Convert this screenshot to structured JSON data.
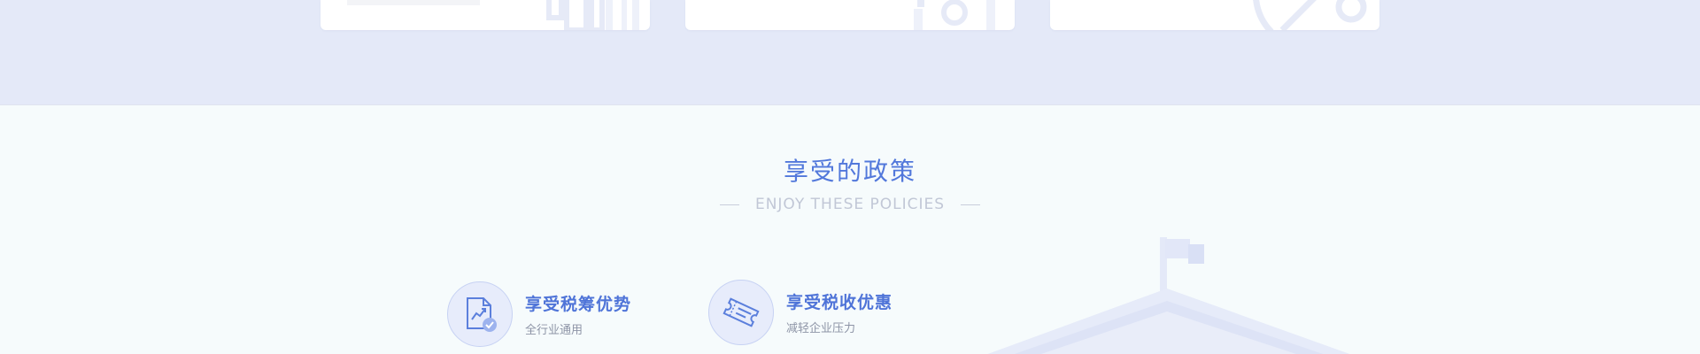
{
  "section": {
    "title": "享受的政策",
    "subtitle": "ENJOY THESE POLICIES"
  },
  "policies": [
    {
      "title": "享受税筹优势",
      "desc": "全行业通用",
      "icon": "chart-document-icon"
    },
    {
      "title": "享受税收优惠",
      "desc": "减轻企业压力",
      "icon": "ticket-icon"
    }
  ],
  "colors": {
    "accent": "#5278db",
    "band": "#e4e9f8",
    "background": "#f6fbfc",
    "subtitle": "#c1c7d6"
  }
}
